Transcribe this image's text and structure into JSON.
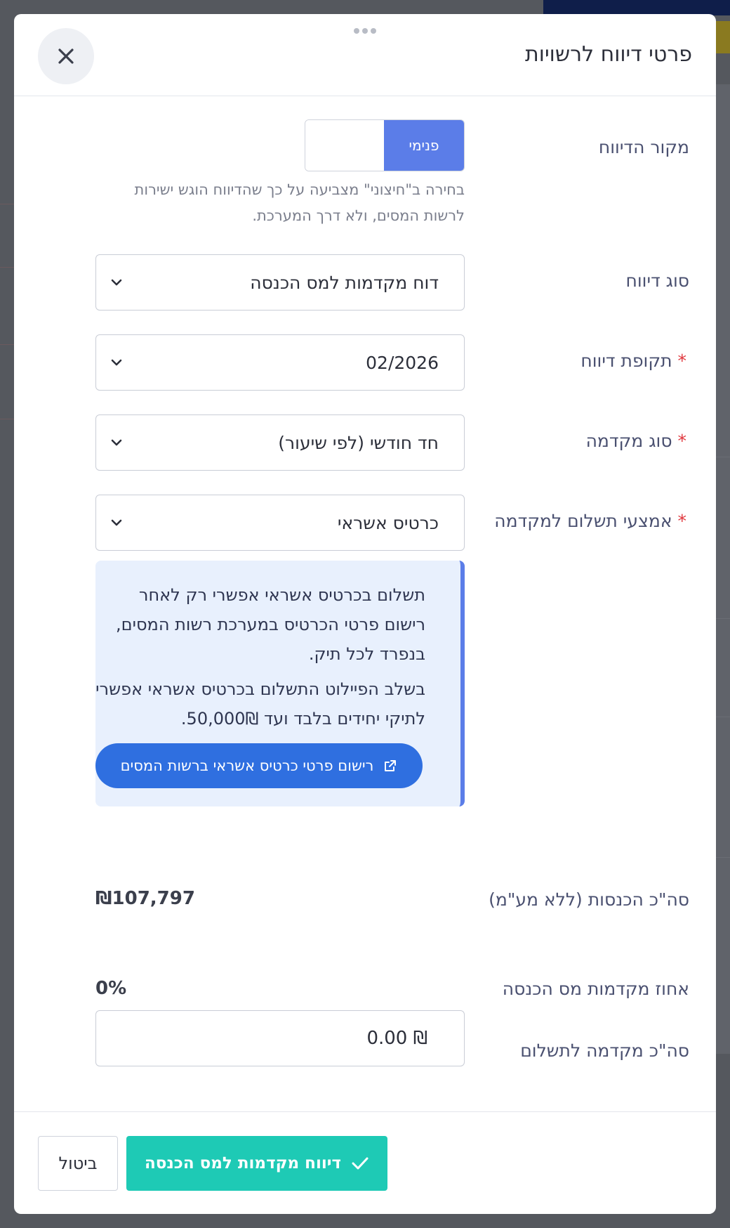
{
  "modal": {
    "title": "פרטי דיווח לרשויות",
    "close_icon": "close-icon",
    "drag_handle_icon": "drag-handle-icon"
  },
  "form": {
    "report_source": {
      "label": "מקור הדיווח",
      "active_option": "פנימי",
      "inactive_option": "",
      "hint": "בחירה ב\"חיצוני\" מצביעה על כך שהדיווח הוגש ישירות לרשות המסים, ולא דרך המערכת."
    },
    "report_type": {
      "label": "סוג דיווח",
      "value": "דוח מקדמות למס הכנסה"
    },
    "report_period": {
      "label": "תקופת דיווח",
      "required": "*",
      "value": "02/2026"
    },
    "advance_type": {
      "label": "סוג מקדמה",
      "required": "*",
      "value": "חד חודשי (לפי שיעור)"
    },
    "payment_method": {
      "label": "אמצעי תשלום למקדמה",
      "required": "*",
      "value": "כרטיס אשראי"
    },
    "info": {
      "paragraph1": "תשלום בכרטיס אשראי אפשרי רק לאחר רישום פרטי הכרטיס במערכת רשות המסים, בנפרד לכל תיק.",
      "paragraph2": "בשלב הפיילוט התשלום בכרטיס אשראי אפשרי לתיקי יחידים בלבד ועד 50,000₪.",
      "button_label": "רישום פרטי כרטיס אשראי ברשות המסים",
      "button_icon": "external-link-icon"
    },
    "total_income": {
      "label": "סה\"כ הכנסות (ללא מע\"מ)",
      "value": "₪107,797"
    },
    "advance_percent": {
      "label": "אחוז מקדמות מס הכנסה",
      "value": "0%"
    },
    "total_advance": {
      "label": "סה\"כ מקדמה לתשלום",
      "value": "₪ 0.00"
    }
  },
  "footer": {
    "submit_label": "דיווח מקדמות למס הכנסה",
    "submit_icon": "check-icon",
    "cancel_label": "ביטול"
  },
  "colors": {
    "primary": "#5b7de8",
    "link_button": "#2f6fe0",
    "submit": "#1ecab5",
    "required": "#e0383e",
    "info_bg": "#e8f0fd"
  }
}
